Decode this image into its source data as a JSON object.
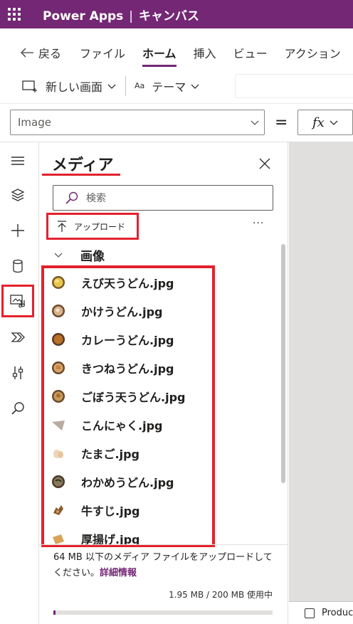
{
  "header": {
    "app_name": "Power Apps",
    "separator": "|",
    "mode": "キャンバス"
  },
  "ribbon": {
    "back_label": "戻る",
    "tabs": [
      {
        "label": "ファイル",
        "active": false
      },
      {
        "label": "ホーム",
        "active": true
      },
      {
        "label": "挿入",
        "active": false
      },
      {
        "label": "ビュー",
        "active": false
      },
      {
        "label": "アクション",
        "active": false
      }
    ]
  },
  "commands": {
    "new_screen": "新しい画面",
    "theme_icon_text": "Aa",
    "theme": "テーマ"
  },
  "formula_bar": {
    "property": "Image",
    "equals": "=",
    "fx": "fx"
  },
  "rail": {
    "active_item": "media-icon"
  },
  "media_panel": {
    "title": "メディア",
    "search_placeholder": "検索",
    "upload_label": "アップロード",
    "more": "···",
    "section_label": "画像",
    "items": [
      {
        "name": "えび天うどん.jpg",
        "thumb": "tempura-udon"
      },
      {
        "name": "かけうどん.jpg",
        "thumb": "kake-udon"
      },
      {
        "name": "カレーうどん.jpg",
        "thumb": "curry-udon"
      },
      {
        "name": "きつねうどん.jpg",
        "thumb": "kitsune-udon"
      },
      {
        "name": "ごぼう天うどん.jpg",
        "thumb": "gobo-udon"
      },
      {
        "name": "こんにゃく.jpg",
        "thumb": "konnyaku"
      },
      {
        "name": "たまご.jpg",
        "thumb": "egg"
      },
      {
        "name": "わかめうどん.jpg",
        "thumb": "wakame-udon"
      },
      {
        "name": "牛すじ.jpg",
        "thumb": "gyusuji"
      },
      {
        "name": "厚揚げ.jpg",
        "thumb": "atsuage"
      }
    ],
    "footer_text": "64 MB 以下のメディア ファイルをアップロードしてください。",
    "footer_link": "詳細情報",
    "usage": "1.95 MB / 200 MB 使用中",
    "usage_fraction": 0.00975
  },
  "canvas": {
    "footer_label": "Products"
  },
  "colors": {
    "brand": "#742774",
    "highlight": "#e3222d"
  }
}
